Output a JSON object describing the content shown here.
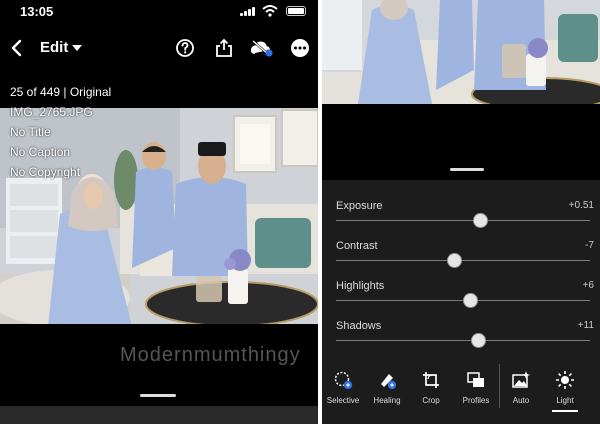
{
  "status_bar": {
    "time": "13:05"
  },
  "top_bar": {
    "back_icon": "chevron-left-icon",
    "edit_label": "Edit",
    "icons": [
      "help-icon",
      "share-icon",
      "cloud-sync-icon",
      "more-icon"
    ]
  },
  "photo_info": {
    "count_line": "25 of 449 | Original",
    "filename": "IMG_2765.JPG",
    "title": "No Title",
    "caption": "No Caption",
    "copyright": "No Copyright"
  },
  "watermark": "Modernmumthingy",
  "light_panel": {
    "sliders": [
      {
        "label": "Exposure",
        "value": "+0.51",
        "level": 0.57
      },
      {
        "label": "Contrast",
        "value": "-7",
        "level": 0.465
      },
      {
        "label": "Highlights",
        "value": "+6",
        "level": 0.53
      },
      {
        "label": "Shadows",
        "value": "+11",
        "level": 0.56
      }
    ]
  },
  "toolbar": {
    "tools": [
      {
        "label": "Selective",
        "icon": "selective-icon"
      },
      {
        "label": "Healing",
        "icon": "healing-brush-icon"
      },
      {
        "label": "Crop",
        "icon": "crop-icon"
      },
      {
        "label": "Profiles",
        "icon": "profiles-icon"
      },
      {
        "label": "Auto",
        "icon": "auto-icon"
      },
      {
        "label": "Light",
        "icon": "light-sun-icon"
      }
    ],
    "active": "Light"
  },
  "colors": {
    "accent": "#2f6fe8",
    "panel_bg": "#1c1c1c"
  }
}
